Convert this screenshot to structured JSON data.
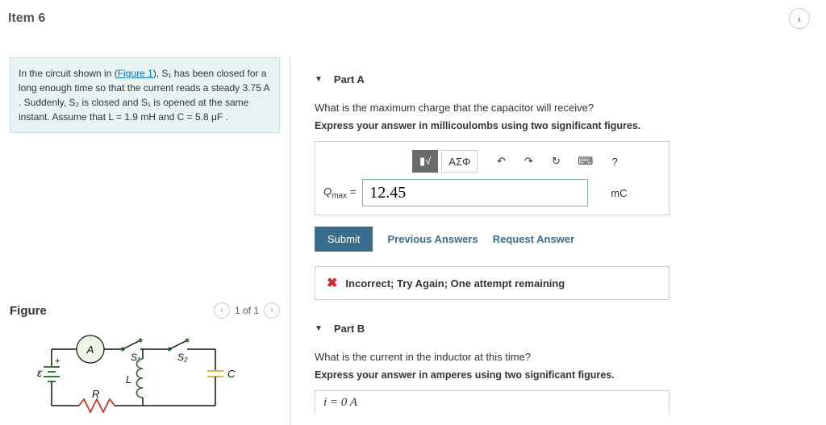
{
  "header": {
    "title": "Item 6"
  },
  "problem": {
    "text_pre": "In the circuit shown in (",
    "fig_link": "Figure 1",
    "text_post1": "), S₁ has been closed for a long enough time so that the current reads a steady 3.75 A . Suddenly, S₂ is closed and S₁ is opened at the same instant. Assume that L = 1.9 mH and C = 5.8 μF ."
  },
  "figure": {
    "heading": "Figure",
    "pager": "1 of 1"
  },
  "partA": {
    "label": "Part A",
    "question": "What is the maximum charge that the capacitor will receive?",
    "instruction": "Express your answer in millicoulombs using two significant figures.",
    "toolbar": {
      "templates_icon": "▮√",
      "greek": "ΑΣΦ",
      "undo": "↶",
      "redo": "↷",
      "reset": "↻",
      "keyboard": "⌨",
      "help": "?"
    },
    "answer_label_sym": "Q",
    "answer_label_sub": "max",
    "equals": " = ",
    "answer_value": "12.45",
    "unit": "mC",
    "submit": "Submit",
    "prev_answers": "Previous Answers",
    "request_answer": "Request Answer",
    "feedback": "Incorrect; Try Again; One attempt remaining"
  },
  "partB": {
    "label": "Part B",
    "question": "What is the current in the inductor at this time?",
    "instruction": "Express your answer in amperes using two significant figures.",
    "answer_display": "i = 0  A"
  }
}
